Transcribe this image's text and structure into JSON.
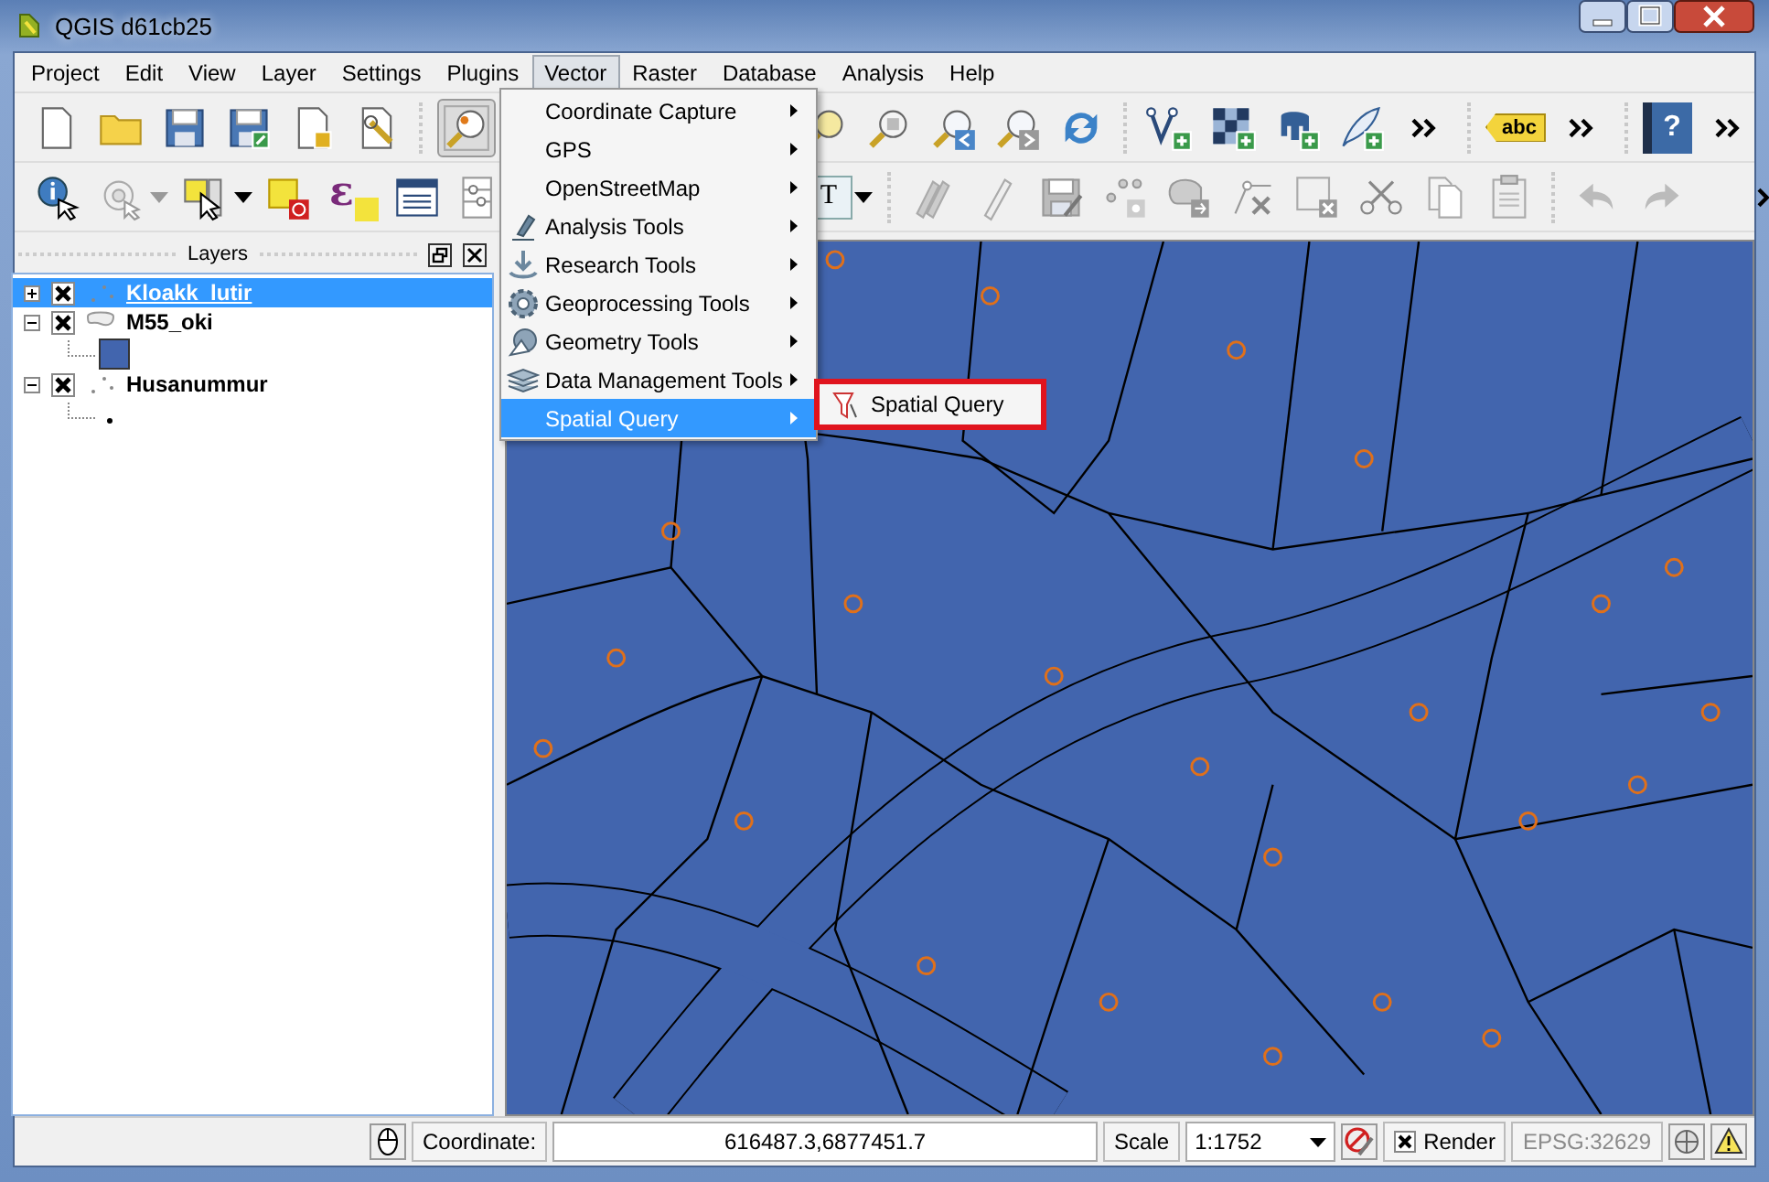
{
  "window": {
    "title": "QGIS d61cb25"
  },
  "menubar": [
    {
      "label": "Project",
      "selected": false
    },
    {
      "label": "Edit",
      "selected": false
    },
    {
      "label": "View",
      "selected": false
    },
    {
      "label": "Layer",
      "selected": false
    },
    {
      "label": "Settings",
      "selected": false
    },
    {
      "label": "Plugins",
      "selected": false
    },
    {
      "label": "Vector",
      "selected": true
    },
    {
      "label": "Raster",
      "selected": false
    },
    {
      "label": "Database",
      "selected": false
    },
    {
      "label": "Analysis",
      "selected": false
    },
    {
      "label": "Help",
      "selected": false
    }
  ],
  "vector_menu": [
    {
      "label": "Coordinate Capture",
      "selected": false
    },
    {
      "label": "GPS",
      "selected": false
    },
    {
      "label": "OpenStreetMap",
      "selected": false
    },
    {
      "label": "Analysis Tools",
      "selected": false
    },
    {
      "label": "Research Tools",
      "selected": false
    },
    {
      "label": "Geoprocessing Tools",
      "selected": false
    },
    {
      "label": "Geometry Tools",
      "selected": false
    },
    {
      "label": "Data Management Tools",
      "selected": false
    },
    {
      "label": "Spatial Query",
      "selected": true
    }
  ],
  "submenu": [
    {
      "label": "Spatial Query",
      "highlighted": true
    }
  ],
  "toolbar": {
    "label_tool_text": "abc",
    "help_glyph": "?",
    "annotation_glyph": "T",
    "expression_glyph": "ε"
  },
  "layers_panel": {
    "title": "Layers",
    "layers": [
      {
        "name": "Kloakk_lutir",
        "kind": "point",
        "checked": true,
        "expanded": false,
        "selected": true
      },
      {
        "name": "M55_oki",
        "kind": "polygon",
        "checked": true,
        "expanded": true,
        "selected": false
      },
      {
        "name": "Husanummur",
        "kind": "point",
        "checked": true,
        "expanded": true,
        "selected": false
      }
    ]
  },
  "status_bar": {
    "coordinate_label": "Coordinate:",
    "coordinate": "616487.3,6877451.7",
    "scale_label": "Scale",
    "scale": "1:1752",
    "render_label": "Render",
    "render_checked": true,
    "crs": "EPSG:32629"
  }
}
